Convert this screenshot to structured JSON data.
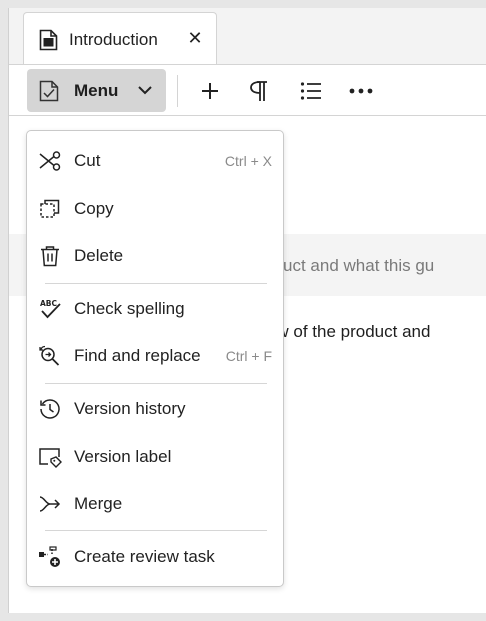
{
  "tab": {
    "title": "Introduction",
    "close_glyph": "✕",
    "icon": "document-icon"
  },
  "toolbar": {
    "menu_label": "Menu",
    "menu_icon": "document-check-icon",
    "buttons": [
      "plus-icon",
      "pilcrow-icon",
      "list-icon",
      "more-icon"
    ]
  },
  "content": {
    "line1": "product and what this gu",
    "line2": "rview of the product and"
  },
  "menu": {
    "items": [
      {
        "label": "Cut",
        "shortcut": "Ctrl + X",
        "icon": "scissors-icon"
      },
      {
        "label": "Copy",
        "shortcut": "",
        "icon": "copy-icon"
      },
      {
        "label": "Delete",
        "shortcut": "",
        "icon": "trash-icon"
      },
      {
        "label": "Check spelling",
        "shortcut": "",
        "icon": "spellcheck-icon"
      },
      {
        "label": "Find and replace",
        "shortcut": "Ctrl + F",
        "icon": "find-replace-icon"
      },
      {
        "label": "Version history",
        "shortcut": "",
        "icon": "history-icon"
      },
      {
        "label": "Version label",
        "shortcut": "",
        "icon": "label-icon"
      },
      {
        "label": "Merge",
        "shortcut": "",
        "icon": "merge-icon"
      },
      {
        "label": "Create review task",
        "shortcut": "",
        "icon": "review-task-icon"
      }
    ]
  },
  "colors": {
    "background": "#e6e6e6",
    "menu_button_bg": "#d5d5d5",
    "text": "#222222",
    "shortcut_text": "#8a8a8a"
  }
}
